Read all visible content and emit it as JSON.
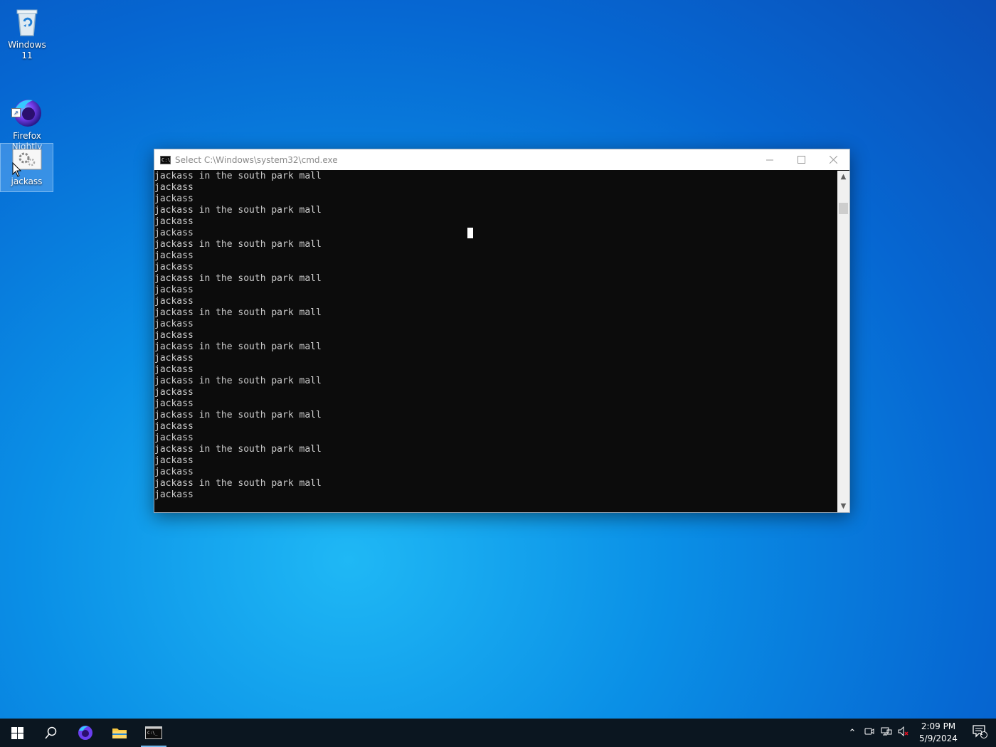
{
  "desktop": {
    "icons": [
      {
        "label": "Windows 11"
      },
      {
        "label": "Firefox\nNightly"
      },
      {
        "label": "jackass"
      }
    ]
  },
  "cmd_window": {
    "title": "Select C:\\Windows\\system32\\cmd.exe",
    "lines": [
      "jackass in the south park mall",
      "jackass",
      "jackass",
      "jackass in the south park mall",
      "jackass",
      "jackass",
      "jackass in the south park mall",
      "jackass",
      "jackass",
      "jackass in the south park mall",
      "jackass",
      "jackass",
      "jackass in the south park mall",
      "jackass",
      "jackass",
      "jackass in the south park mall",
      "jackass",
      "jackass",
      "jackass in the south park mall",
      "jackass",
      "jackass",
      "jackass in the south park mall",
      "jackass",
      "jackass",
      "jackass in the south park mall",
      "jackass",
      "jackass",
      "jackass in the south park mall",
      "jackass"
    ]
  },
  "taskbar": {
    "clock_time": "2:09 PM",
    "clock_date": "5/9/2024",
    "notification_count": "1"
  }
}
